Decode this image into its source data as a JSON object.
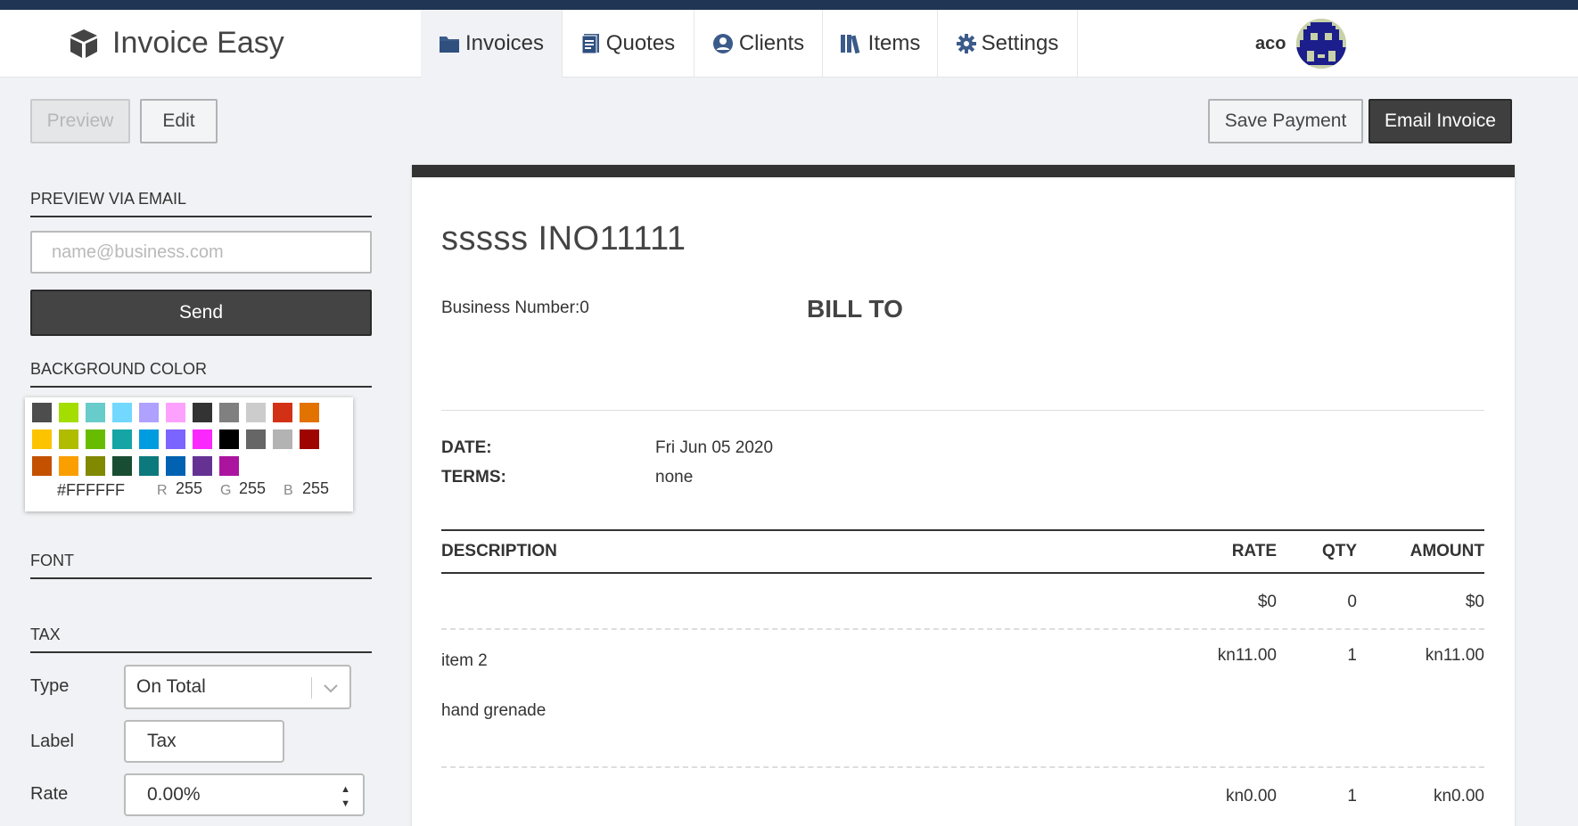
{
  "app": {
    "name": "Invoice Easy"
  },
  "nav": {
    "items": [
      {
        "label": "Invoices",
        "icon": "folder-icon",
        "active": true
      },
      {
        "label": "Quotes",
        "icon": "document-icon",
        "active": false
      },
      {
        "label": "Clients",
        "icon": "user-circle-icon",
        "active": false
      },
      {
        "label": "Items",
        "icon": "books-icon",
        "active": false
      },
      {
        "label": "Settings",
        "icon": "gear-icon",
        "active": false
      }
    ]
  },
  "user": {
    "name": "aco",
    "avatar_icon": "pixel-avatar-icon"
  },
  "toolbar": {
    "preview_label": "Preview",
    "edit_label": "Edit",
    "save_payment_label": "Save Payment",
    "email_invoice_label": "Email Invoice"
  },
  "sidebar": {
    "preview_email": {
      "title": "PREVIEW VIA EMAIL",
      "placeholder": "name@business.com",
      "value": "",
      "send_label": "Send"
    },
    "background_color": {
      "title": "BACKGROUND COLOR",
      "swatches": [
        "#4d4d4d",
        "#a4dd00",
        "#68ccca",
        "#73d8ff",
        "#aea1ff",
        "#fda1ff",
        "#333333",
        "#808080",
        "#cccccc",
        "#d33115",
        "#e27300",
        "#fcc400",
        "#b0bc00",
        "#68bc00",
        "#16a5a5",
        "#009ce0",
        "#7b64ff",
        "#fa28ff",
        "#000000",
        "#666666",
        "#b3b3b3",
        "#9f0500",
        "#c45100",
        "#fb9e00",
        "#808900",
        "#194d33",
        "#0c797d",
        "#0062b1",
        "#653294",
        "#ab149e"
      ],
      "hex": "#FFFFFF",
      "r_label": "R",
      "r": "255",
      "g_label": "G",
      "g": "255",
      "b_label": "B",
      "b": "255"
    },
    "font": {
      "title": "FONT"
    },
    "tax": {
      "title": "TAX",
      "type_label": "Type",
      "type_value": "On Total",
      "label_label": "Label",
      "label_value": "Tax",
      "rate_label": "Rate",
      "rate_value": "0.00%"
    }
  },
  "invoice": {
    "title": "sssss INO11111",
    "business_number": "Business Number:0",
    "bill_to": "BILL TO",
    "date_label": "DATE:",
    "date_value": "Fri Jun 05 2020",
    "terms_label": "TERMS:",
    "terms_value": "none",
    "columns": {
      "description": "DESCRIPTION",
      "rate": "RATE",
      "qty": "QTY",
      "amount": "AMOUNT"
    },
    "rows": [
      {
        "description": "",
        "note": "",
        "rate": "$0",
        "qty": "0",
        "amount": "$0"
      },
      {
        "description": "item 2",
        "note": "hand grenade",
        "rate": "kn11.00",
        "qty": "1",
        "amount": "kn11.00"
      },
      {
        "description": "",
        "note": "",
        "rate": "kn0.00",
        "qty": "1",
        "amount": "kn0.00"
      }
    ]
  }
}
